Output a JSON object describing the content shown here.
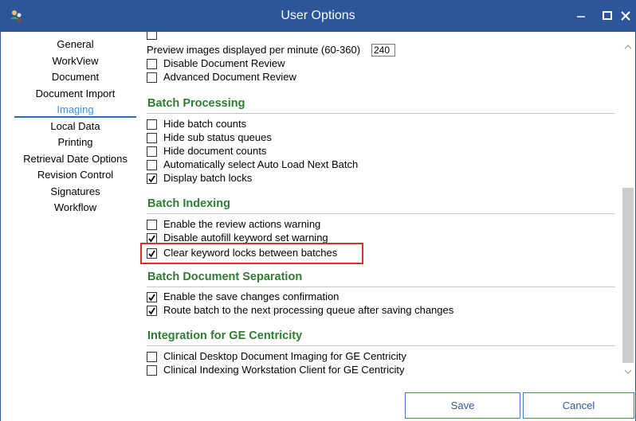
{
  "window": {
    "title": "User Options",
    "title_bar_color": "#2b579a",
    "app_icon": "user-options-app-icon",
    "buttons": {
      "minimize": "minimize-icon",
      "maximize": "maximize-icon",
      "close": "close-icon"
    }
  },
  "nav": {
    "items": [
      {
        "label": "General"
      },
      {
        "label": "WorkView"
      },
      {
        "label": "Document"
      },
      {
        "label": "Document Import"
      },
      {
        "label": "Imaging"
      },
      {
        "label": "Local Data"
      },
      {
        "label": "Printing"
      },
      {
        "label": "Retrieval Date Options"
      },
      {
        "label": "Revision Control"
      },
      {
        "label": "Signatures"
      },
      {
        "label": "Workflow"
      }
    ],
    "selected": "Imaging",
    "selected_color": "#3b8fd8"
  },
  "content": {
    "preview_images_label": "Preview images displayed per minute (60-360)",
    "preview_images_value": "240",
    "top_options": [
      {
        "label": "Disable Document Review",
        "checked": false
      },
      {
        "label": "Advanced Document Review",
        "checked": false
      }
    ],
    "sections": [
      {
        "title": "Batch Processing",
        "options": [
          {
            "label": "Hide batch counts",
            "checked": false
          },
          {
            "label": "Hide sub status queues",
            "checked": false
          },
          {
            "label": "Hide document counts",
            "checked": false
          },
          {
            "label": "Automatically select Auto Load Next Batch",
            "checked": false
          },
          {
            "label": "Display batch locks",
            "checked": true
          }
        ]
      },
      {
        "title": "Batch Indexing",
        "options": [
          {
            "label": "Enable the review actions warning",
            "checked": false
          },
          {
            "label": "Disable autofill keyword set warning",
            "checked": true
          },
          {
            "label": "Clear keyword locks between batches",
            "checked": true
          }
        ]
      },
      {
        "title": "Batch Document Separation",
        "options": [
          {
            "label": "Enable the save changes confirmation",
            "checked": true
          },
          {
            "label": "Route batch to the next processing queue after saving changes",
            "checked": true
          }
        ]
      },
      {
        "title": "Integration for GE Centricity",
        "options": [
          {
            "label": "Clinical Desktop Document Imaging for GE Centricity",
            "checked": false
          },
          {
            "label": "Clinical Indexing Workstation Client for GE Centricity",
            "checked": false
          }
        ]
      }
    ],
    "section_color": "#2e7d32",
    "highlight_color": "#d9302a"
  },
  "footer": {
    "save_label": "Save",
    "cancel_label": "Cancel"
  }
}
